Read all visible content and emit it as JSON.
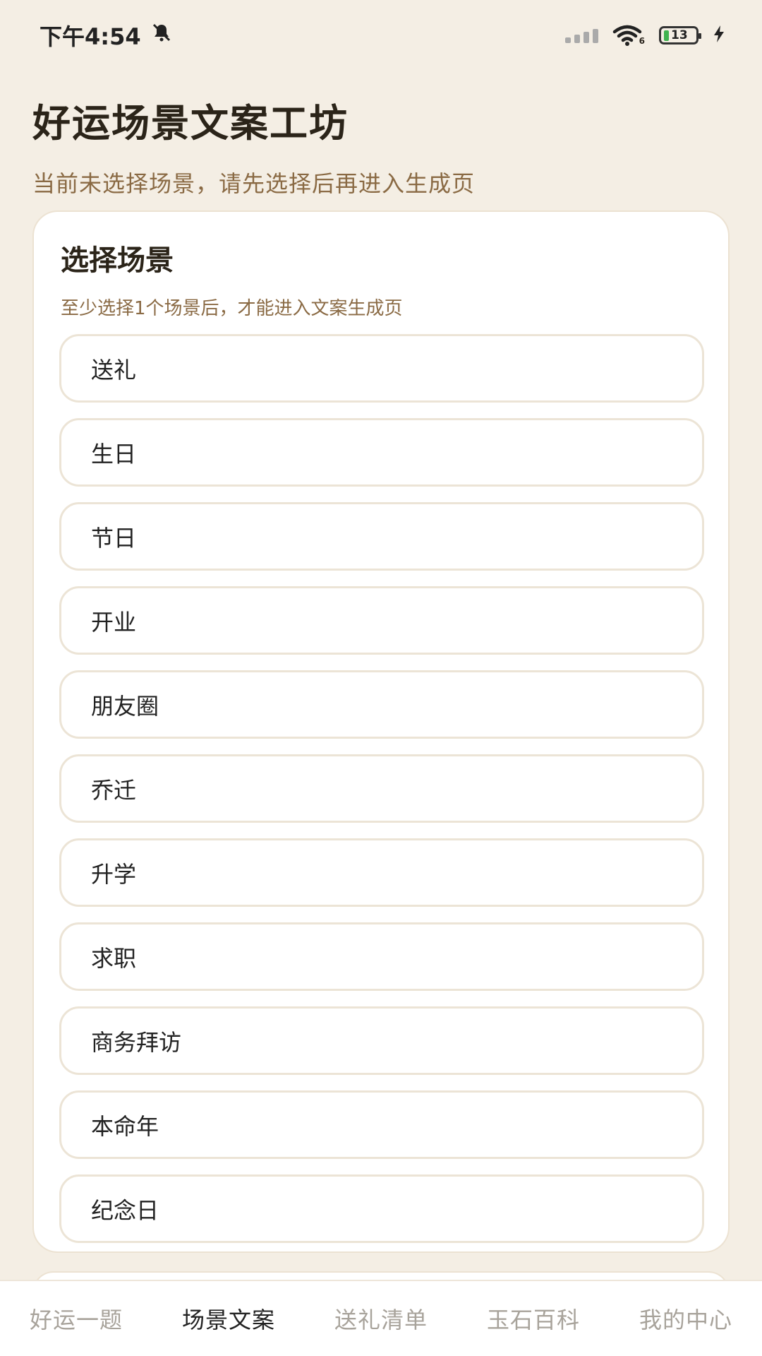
{
  "status_bar": {
    "time": "下午4:54",
    "wifi_label": "6",
    "battery_level": "13"
  },
  "header": {
    "title": "好运场景文案工坊",
    "subtitle": "当前未选择场景，请先选择后再进入生成页"
  },
  "scene_card": {
    "title": "选择场景",
    "subtitle": "至少选择1个场景后，才能进入文案生成页",
    "options": [
      "送礼",
      "生日",
      "节日",
      "开业",
      "朋友圈",
      "乔迁",
      "升学",
      "求职",
      "商务拜访",
      "本命年",
      "纪念日"
    ]
  },
  "tabs": [
    {
      "label": "好运一题",
      "active": false
    },
    {
      "label": "场景文案",
      "active": true
    },
    {
      "label": "送礼清单",
      "active": false
    },
    {
      "label": "玉石百科",
      "active": false
    },
    {
      "label": "我的中心",
      "active": false
    }
  ],
  "colors": {
    "background": "#f4eee4",
    "accent_text": "#8a6a44",
    "active_tab": "#222222",
    "inactive_tab": "#a8a39b"
  }
}
